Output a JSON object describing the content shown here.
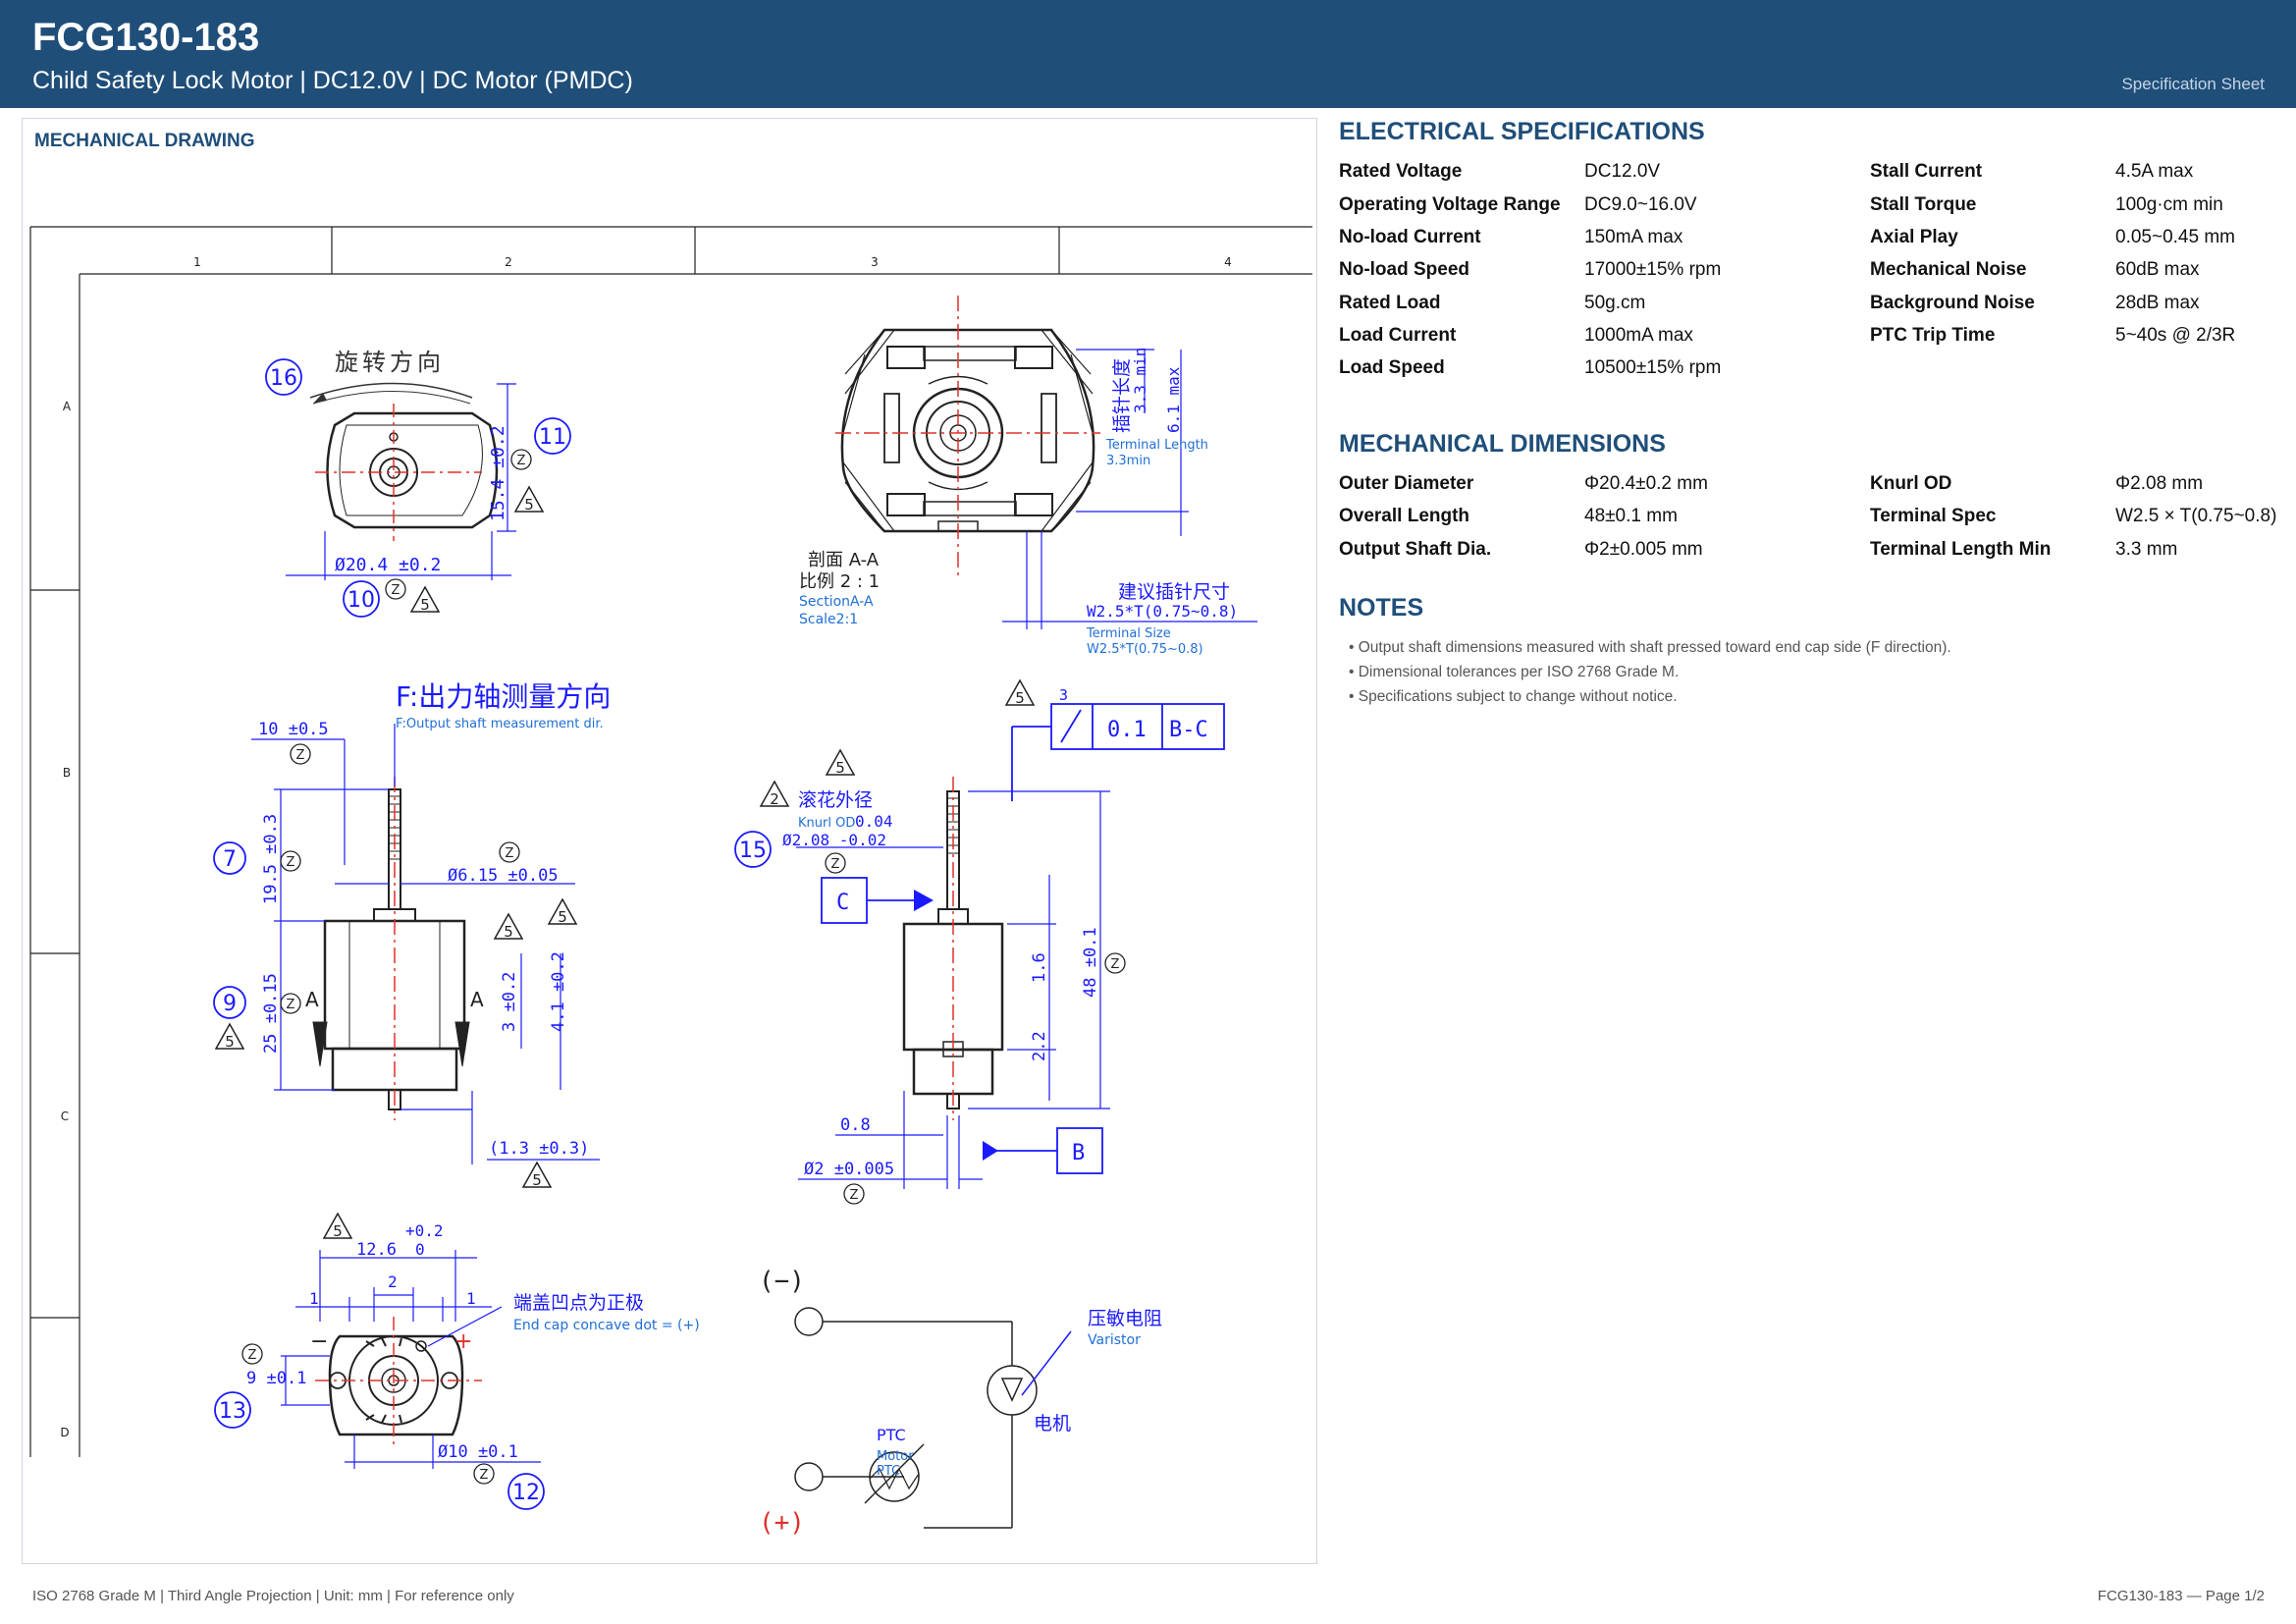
{
  "header": {
    "title": "FCG130-183",
    "subtitle": "Child Safety Lock Motor  |  DC12.0V  |  DC Motor (PMDC)",
    "sheet_label": "Specification Sheet"
  },
  "drawing": {
    "panel_title": "MECHANICAL DRAWING",
    "columns": [
      "1",
      "2",
      "3",
      "4"
    ],
    "rows": [
      "A",
      "B",
      "C",
      "D"
    ],
    "labels": {
      "rotation_dir": "旋转方向",
      "dia_20_4": "Ø20.4 ±0.2",
      "dim_15_4": "15.4 ±0.2",
      "section_aa": "剖面 A-A",
      "scale": "比例 2 : 1",
      "section_en": "SectionA-A",
      "scale_en": "Scale2:1",
      "terminal_length_cn": "插针长度",
      "terminal_min": "3.3 min",
      "terminal_max": "6.1 max",
      "terminal_length_en": "Terminal Length",
      "terminal_length_val": "3.3min",
      "pin_size_cn": "建议插针尺寸",
      "pin_size": "W2.5*T(0.75~0.8)",
      "terminal_size_en": "Terminal Size",
      "terminal_size_val": "W2.5*T(0.75~0.8)",
      "f_dir_cn": "F:出力轴测量方向",
      "f_dir_en": "F:Output shaft measurement dir.",
      "dim_10": "10 ±0.5",
      "dim_19_5": "19.5 ±0.3",
      "dia_6_15": "Ø6.15 ±0.05",
      "dim_25": "25 ±0.15",
      "dim_3": "3 ±0.2",
      "dim_4_1": "4.1 ±0.2",
      "dim_1_3": "(1.3 ±0.3)",
      "knurl_cn": "滚花外径",
      "knurl_en": "Knurl OD",
      "knurl_tol": "0.04",
      "knurl_dia": "Ø2.08 -0.02",
      "runout": "0.1",
      "datum_bc": "B-C",
      "datum_c": "C",
      "datum_b": "B",
      "dim_48": "48 ±0.1",
      "dim_1_6": "1.6",
      "dim_2_2": "2.2",
      "dim_0_8": "0.8",
      "dia_2": "Ø2 ±0.005",
      "dim_12_6_tol": "+0.2",
      "dim_12_6": "12.6",
      "dim_12_6_low": "0",
      "dim_2": "2",
      "dim_1": "1",
      "endcap_cn": "端盖凹点为正极",
      "endcap_en": "End cap concave dot = (+)",
      "dim_9": "9 ±0.1",
      "dia_10": "Ø10 ±0.1",
      "minus": "(−)",
      "plus": "(+)",
      "varistor_cn": "压敏电阻",
      "varistor_en": "Varistor",
      "motor_cn": "电机",
      "ptc": "PTC",
      "motor_ptc_1": "Motor",
      "motor_ptc_2": "PTC",
      "three": "3",
      "letter_a": "A",
      "z": "Z",
      "five": "5",
      "two": "2",
      "b16": "16",
      "b11": "11",
      "b10": "10",
      "b7": "7",
      "b9": "9",
      "b15": "15",
      "b13": "13",
      "b12": "12"
    }
  },
  "electrical": {
    "title": "ELECTRICAL SPECIFICATIONS",
    "left": [
      {
        "label": "Rated Voltage",
        "value": "DC12.0V"
      },
      {
        "label": "Operating Voltage Range",
        "value": "DC9.0~16.0V"
      },
      {
        "label": "No-load Current",
        "value": "150mA max"
      },
      {
        "label": "No-load Speed",
        "value": "17000±15% rpm"
      },
      {
        "label": "Rated Load",
        "value": "50g.cm"
      },
      {
        "label": "Load Current",
        "value": "1000mA max"
      },
      {
        "label": "Load Speed",
        "value": "10500±15% rpm"
      }
    ],
    "right": [
      {
        "label": "Stall Current",
        "value": "4.5A max"
      },
      {
        "label": "Stall Torque",
        "value": "100g·cm min"
      },
      {
        "label": "Axial Play",
        "value": "0.05~0.45 mm"
      },
      {
        "label": "Mechanical Noise",
        "value": "60dB max"
      },
      {
        "label": "Background Noise",
        "value": "28dB max"
      },
      {
        "label": "PTC Trip Time",
        "value": "5~40s @ 2/3R"
      }
    ]
  },
  "mechanical": {
    "title": "MECHANICAL DIMENSIONS",
    "left": [
      {
        "label": "Outer Diameter",
        "value": "Φ20.4±0.2 mm"
      },
      {
        "label": "Overall Length",
        "value": "48±0.1 mm"
      },
      {
        "label": "Output Shaft Dia.",
        "value": "Φ2±0.005 mm"
      }
    ],
    "right": [
      {
        "label": "Knurl OD",
        "value": "Φ2.08 mm"
      },
      {
        "label": "Terminal Spec",
        "value": "W2.5 × T(0.75~0.8) mm"
      },
      {
        "label": "Terminal Length Min",
        "value": "3.3 mm"
      }
    ]
  },
  "notes": {
    "title": "NOTES",
    "items": [
      "• Output shaft dimensions measured with shaft pressed toward end cap side (F direction).",
      "• Dimensional tolerances per ISO 2768 Grade M.",
      "• Specifications subject to change without notice."
    ]
  },
  "footer": {
    "left": "ISO 2768 Grade M  |  Third Angle Projection  |  Unit: mm  |  For reference only",
    "right": "FCG130-183  —  Page 1/2"
  },
  "colors": {
    "header_bg": "#1f4e79",
    "accent": "#1f4e79",
    "dimension_blue": "#1a1aff",
    "centerline_red": "#e0302a"
  }
}
